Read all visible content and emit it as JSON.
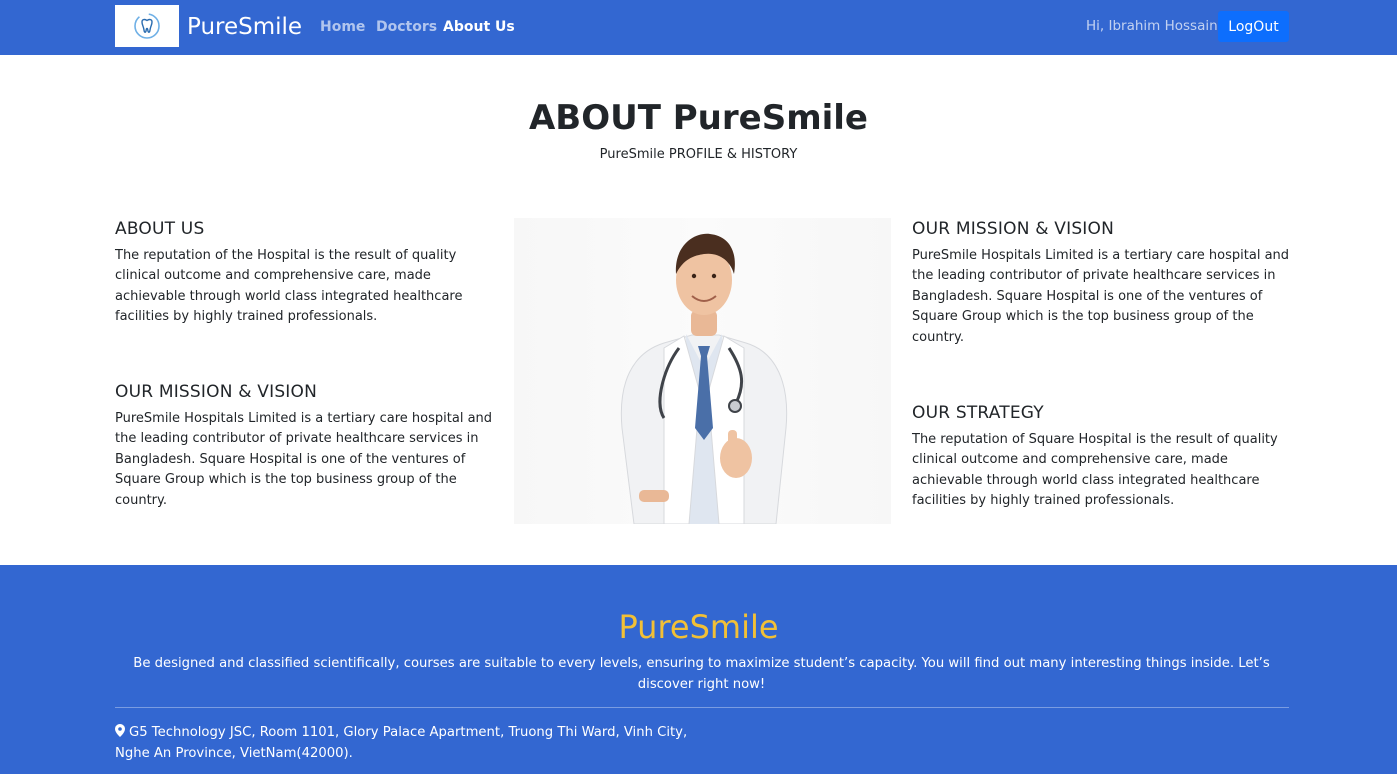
{
  "navbar": {
    "brand": "PureSmile",
    "links": [
      "Home",
      "Doctors",
      "About Us"
    ],
    "active_link": "About Us",
    "greeting": "Hi, Ibrahim Hossain",
    "logout_label": "LogOut"
  },
  "hero": {
    "title": "ABOUT PureSmile",
    "subtitle": "PureSmile PROFILE & HISTORY"
  },
  "left": [
    {
      "heading": "ABOUT US",
      "text": "The reputation of the Hospital is the result of quality clinical outcome and comprehensive care, made achievable through world class integrated healthcare facilities by highly trained professionals."
    },
    {
      "heading": "OUR MISSION & VISION",
      "text": "PureSmile Hospitals Limited is a tertiary care hospital and the leading contributor of private healthcare services in Bangladesh. Square Hospital is one of the ventures of Square Group which is the top business group of the country."
    }
  ],
  "right": [
    {
      "heading": "OUR MISSION & VISION",
      "text": "PureSmile Hospitals Limited is a tertiary care hospital and the leading contributor of private healthcare services in Bangladesh. Square Hospital is one of the ventures of Square Group which is the top business group of the country."
    },
    {
      "heading": "OUR STRATEGY",
      "text": "The reputation of Square Hospital is the result of quality clinical outcome and comprehensive care, made achievable through world class integrated healthcare facilities by highly trained professionals."
    }
  ],
  "footer": {
    "brand": "PureSmile",
    "tagline": "Be designed and classified scientifically, courses are suitable to every levels, ensuring to maximize student’s capacity. You will find out many interesting things inside. Let’s discover right now!",
    "address_line1": "G5 Technology JSC, Room 1101, Glory Palace Apartment, Truong Thi Ward, Vinh City,",
    "address_line2": "Nghe An Province, VietNam(42000)."
  },
  "colors": {
    "primary": "#3367d1",
    "button": "#0d6efd",
    "footer_brand": "#f2c036"
  },
  "icons": {
    "logo": "tooth-icon",
    "address": "map-pin-icon"
  }
}
